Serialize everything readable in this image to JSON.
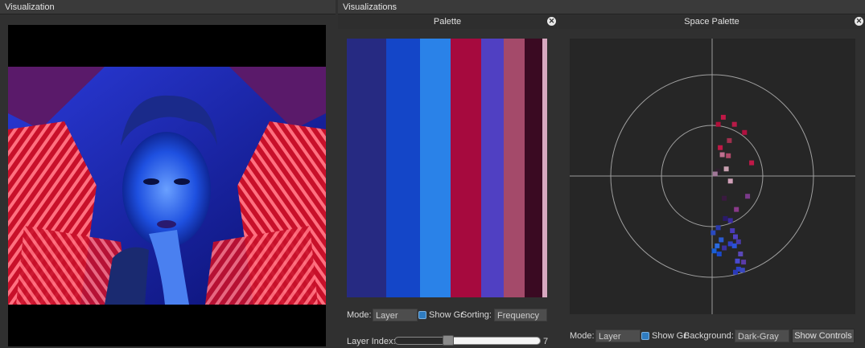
{
  "left_panel": {
    "title": "Visualization"
  },
  "right_panel": {
    "title": "Visualizations"
  },
  "palette": {
    "title": "Palette",
    "close_icon": "close-icon",
    "colors": [
      "#262a82",
      "#1446c8",
      "#2a82e8",
      "#a60a3e",
      "#5040c2",
      "#a44a6a",
      "#3a0a22",
      "#d8a8c0"
    ],
    "mode_label": "Mode:",
    "mode_value": "Layer",
    "show_gr_label": "Show Gr",
    "show_gr_checked": true,
    "sorting_label": "Sorting:",
    "sorting_value": "Frequency",
    "layer_index_label": "Layer Index:",
    "layer_index_value": "7"
  },
  "space_palette": {
    "title": "Space Palette",
    "close_icon": "close-icon",
    "mode_label": "Mode:",
    "mode_value": "Layer",
    "show_gr_label": "Show Gr",
    "show_gr_checked": true,
    "background_label": "Background:",
    "background_value": "Dark-Gray",
    "show_controls_label": "Show Controls",
    "points": [
      {
        "a": 0.06,
        "b": 0.51,
        "c": "#b0103a"
      },
      {
        "a": 0.11,
        "b": 0.58,
        "c": "#c01846"
      },
      {
        "a": 0.22,
        "b": 0.51,
        "c": "#b81a48"
      },
      {
        "a": 0.08,
        "b": 0.28,
        "c": "#c01846"
      },
      {
        "a": 0.32,
        "b": 0.43,
        "c": "#b01040"
      },
      {
        "a": 0.39,
        "b": 0.13,
        "c": "#c01848"
      },
      {
        "a": 0.17,
        "b": 0.35,
        "c": "#a0304e"
      },
      {
        "a": 0.16,
        "b": 0.2,
        "c": "#b04a6a"
      },
      {
        "a": 0.1,
        "b": 0.21,
        "c": "#c07090"
      },
      {
        "a": 0.14,
        "b": 0.07,
        "c": "#c8a0b0"
      },
      {
        "a": 0.06,
        "b": 0.05,
        "c": "#302030"
      },
      {
        "a": 0.18,
        "b": -0.05,
        "c": "#d0a0b8"
      },
      {
        "a": 0.03,
        "b": 0.02,
        "c": "#a07898"
      },
      {
        "a": 0.24,
        "b": -0.33,
        "c": "#8a3a8a"
      },
      {
        "a": 0.35,
        "b": -0.2,
        "c": "#7a3a8a"
      },
      {
        "a": 0.12,
        "b": -0.22,
        "c": "#3a1a40"
      },
      {
        "a": 0.13,
        "b": -0.42,
        "c": "#2a1a6a"
      },
      {
        "a": 0.18,
        "b": -0.44,
        "c": "#3a2aa0"
      },
      {
        "a": 0.06,
        "b": -0.51,
        "c": "#2a3ab0"
      },
      {
        "a": 0.01,
        "b": -0.56,
        "c": "#2a4ac0"
      },
      {
        "a": 0.2,
        "b": -0.54,
        "c": "#4a3ab8"
      },
      {
        "a": 0.23,
        "b": -0.6,
        "c": "#5040c0"
      },
      {
        "a": 0.26,
        "b": -0.65,
        "c": "#4a3aa8"
      },
      {
        "a": 0.09,
        "b": -0.63,
        "c": "#2a5ad0"
      },
      {
        "a": 0.18,
        "b": -0.67,
        "c": "#3040c8"
      },
      {
        "a": 0.22,
        "b": -0.69,
        "c": "#2a52d8"
      },
      {
        "a": 0.05,
        "b": -0.69,
        "c": "#2a6ae0"
      },
      {
        "a": 0.02,
        "b": -0.74,
        "c": "#1a60d8"
      },
      {
        "a": 0.12,
        "b": -0.71,
        "c": "#3a30a0"
      },
      {
        "a": 0.28,
        "b": -0.77,
        "c": "#5a48b8"
      },
      {
        "a": 0.25,
        "b": -0.84,
        "c": "#4a4ad0"
      },
      {
        "a": 0.31,
        "b": -0.85,
        "c": "#5a3aa8"
      },
      {
        "a": 0.26,
        "b": -0.92,
        "c": "#2a40c8"
      },
      {
        "a": 0.3,
        "b": -0.93,
        "c": "#3a48c0"
      },
      {
        "a": 0.23,
        "b": -0.95,
        "c": "#2a3ab8"
      },
      {
        "a": 0.07,
        "b": -0.77,
        "c": "#1a48c8"
      }
    ]
  }
}
